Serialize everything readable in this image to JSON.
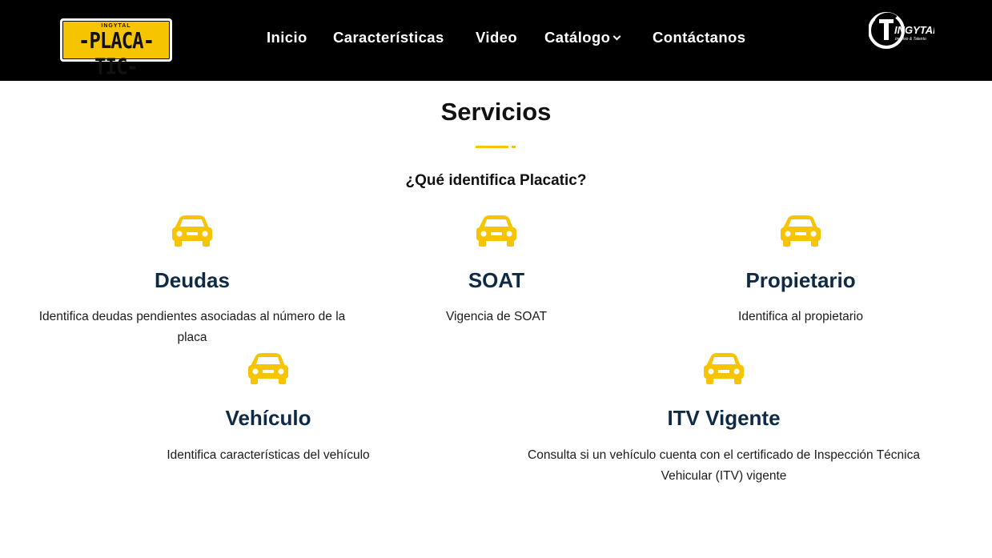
{
  "header": {
    "logo": {
      "top_text": "INGYTAL",
      "main_text": "-PLACA-TIC-"
    },
    "nav": [
      {
        "label": "Inicio"
      },
      {
        "label": "Características"
      },
      {
        "label": "Video"
      },
      {
        "label": "Catálogo",
        "has_dropdown": true
      },
      {
        "label": "Contáctanos"
      }
    ],
    "brand_logo": {
      "name": "INGYTAL",
      "tagline": "Ingenio & Talento"
    }
  },
  "section": {
    "title": "Servicios",
    "subtitle": "¿Qué identifica Placatic?",
    "accent_color": "#f6c400",
    "title_color": "#0f2a44",
    "services": [
      {
        "icon": "car-icon",
        "title": "Deudas",
        "description": "Identifica deudas pendientes asociadas al número de la placa"
      },
      {
        "icon": "car-icon",
        "title": "SOAT",
        "description": "Vigencia de SOAT"
      },
      {
        "icon": "car-icon",
        "title": "Propietario",
        "description": "Identifica al propietario"
      },
      {
        "icon": "car-icon",
        "title": "Vehículo",
        "description": "Identifica características del vehículo"
      },
      {
        "icon": "car-icon",
        "title": "ITV Vigente",
        "description": "Consulta si un vehículo cuenta con el certificado de Inspección Técnica Vehicular (ITV) vigente"
      }
    ]
  }
}
